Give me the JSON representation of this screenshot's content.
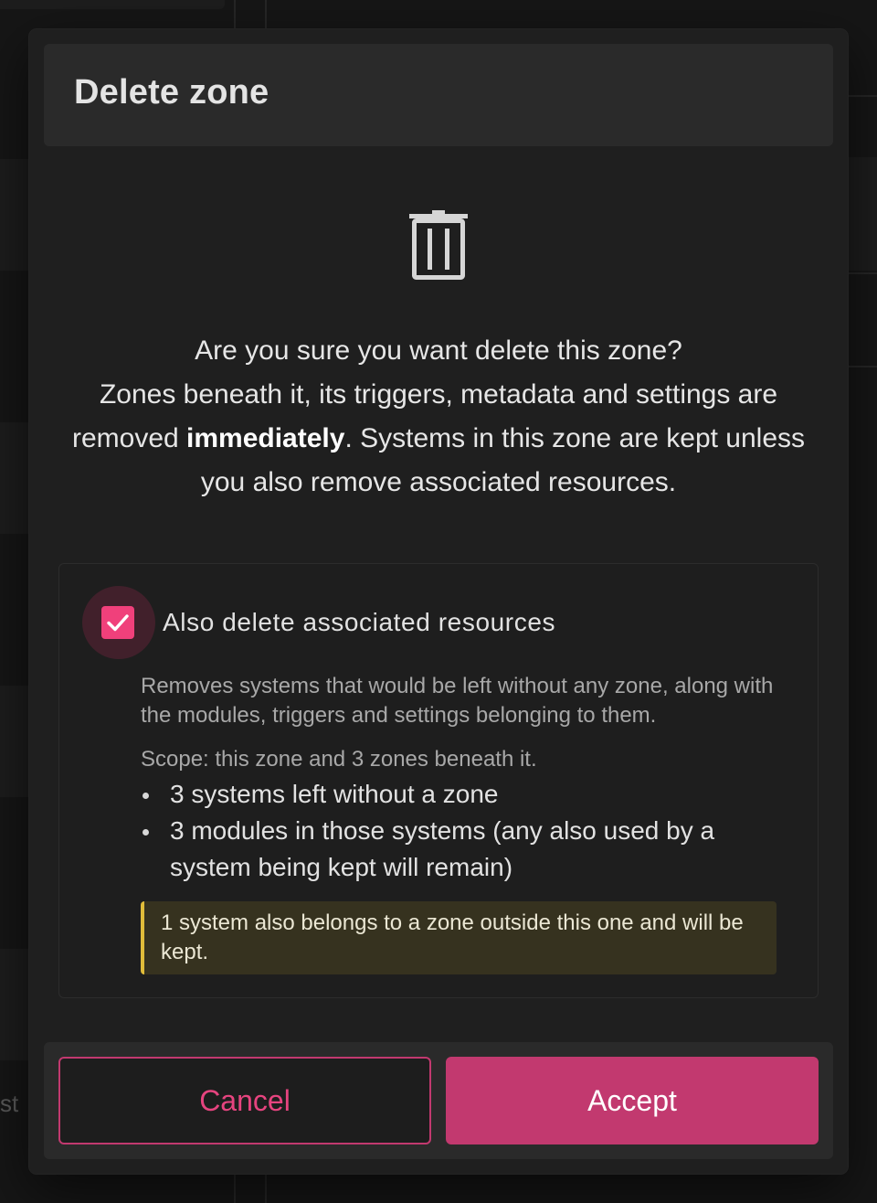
{
  "background": {
    "partial_text": "st"
  },
  "dialog": {
    "title": "Delete zone",
    "icon": "trash-icon",
    "message": {
      "line1": "Are you sure you want delete this zone?",
      "part_before_bold": "Zones beneath it, its triggers, metadata and settings are removed ",
      "bold": "immediately",
      "part_after_bold": ". Systems in this zone are kept unless you also remove associated resources."
    },
    "resources": {
      "checkbox_checked": true,
      "checkbox_label": "Also delete associated resources",
      "description": "Removes systems that would be left without any zone, along with the modules, triggers and settings belonging to them.",
      "scope": "Scope: this zone and 3 zones beneath it.",
      "items": [
        "3 systems left without a zone",
        "3 modules in those systems (any also used by a system being kept will remain)"
      ],
      "warning": "1 system also belongs to a zone outside this one and will be kept."
    },
    "buttons": {
      "cancel": "Cancel",
      "accept": "Accept"
    }
  },
  "colors": {
    "accent": "#c2396f",
    "checkbox": "#f0407b",
    "warning_border": "#e0bc3a",
    "warning_bg": "#36321f",
    "modal_bg": "#1f1f1f",
    "header_bg": "#2a2a2a"
  }
}
